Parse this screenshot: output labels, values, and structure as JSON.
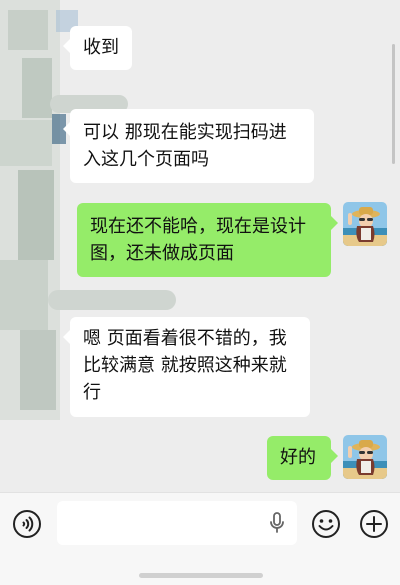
{
  "messages": [
    {
      "side": "in",
      "text": "收到"
    },
    {
      "side": "in",
      "line1": "可以 那现在能实现扫码进",
      "line2": "入这几个页面吗"
    },
    {
      "side": "out",
      "line1": "现在还不能哈，现在是设计",
      "line2": "图，还未做成页面"
    },
    {
      "side": "in",
      "line1": "嗯 页面看着很不错的，我",
      "line2": "比较满意 就按照这种来就",
      "line3": "行"
    },
    {
      "side": "out",
      "text": "好的"
    }
  ],
  "input": {
    "placeholder": ""
  },
  "icons": {
    "voice": "voice-icon",
    "mic": "microphone-icon",
    "emoji": "emoji-icon",
    "plus": "plus-icon"
  },
  "colors": {
    "background": "#ededed",
    "incoming": "#ffffff",
    "outgoing": "#95ec69"
  }
}
